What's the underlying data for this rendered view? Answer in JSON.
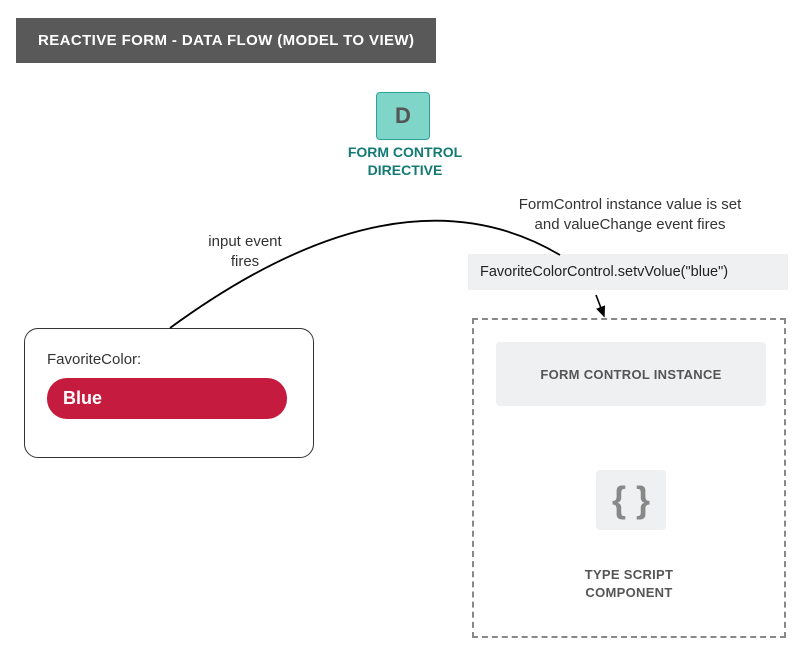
{
  "header": {
    "title": "REACTIVE FORM - DATA FLOW (MODEL TO VIEW)"
  },
  "directive": {
    "letter": "D",
    "label_line1": "FORM CONTROL",
    "label_line2": "DIRECTIVE"
  },
  "annotations": {
    "left_line1": "input event",
    "left_line2": "fires",
    "right_line1": "FormControl instance value is set",
    "right_line2": "and valueChange event fires"
  },
  "code_statement": "FavoriteColorControl.setvVolue(\"blue\")",
  "view": {
    "field_label": "FavoriteColor:",
    "input_value": "Blue"
  },
  "component": {
    "instance_label": "FORM CONTROL INSTANCE",
    "braces": "{ }",
    "ts_line1": "TYPE SCRIPT",
    "ts_line2": "COMPONENT"
  }
}
